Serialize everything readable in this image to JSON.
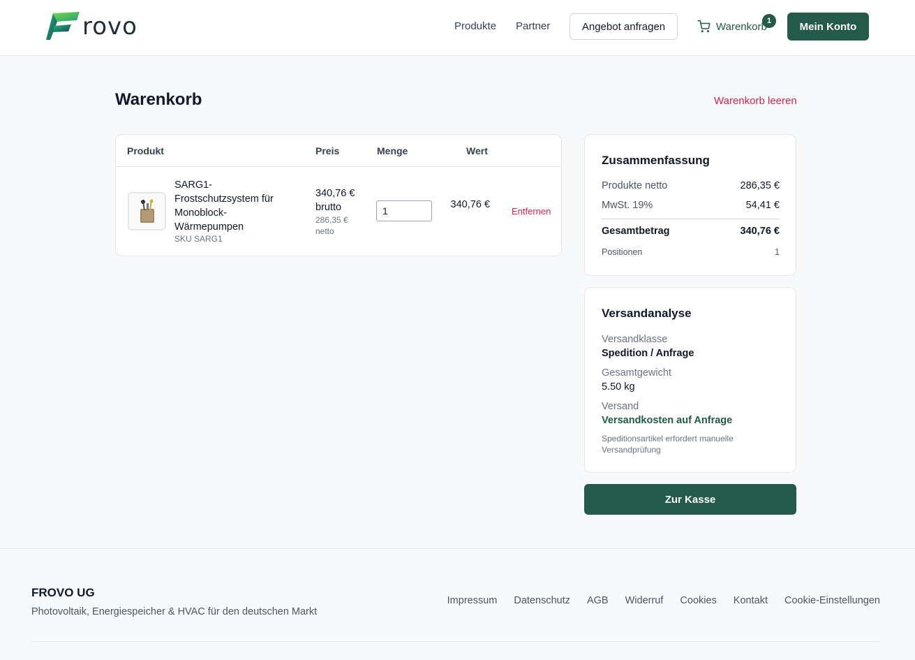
{
  "header": {
    "logo_text": "rovo",
    "nav": [
      "Produkte",
      "Partner"
    ],
    "quote_button": "Angebot anfragen",
    "cart_label": "Warenkorb",
    "cart_count": "1",
    "account_button": "Mein Konto",
    "brand_color": "#245a4a"
  },
  "page": {
    "title": "Warenkorb",
    "clear_cart": "Warenkorb leeren"
  },
  "cart": {
    "columns": {
      "product": "Produkt",
      "price": "Preis",
      "quantity": "Menge",
      "value": "Wert"
    },
    "items": [
      {
        "name": "SARG1-Frostschutzsystem für Monoblock-Wärmepumpen",
        "sku": "SKU SARG1",
        "price_brutto": "340,76 € brutto",
        "price_netto": "286,35 € netto",
        "quantity": "1",
        "value": "340,76 €",
        "remove": "Entfernen"
      }
    ]
  },
  "summary": {
    "title": "Zusammenfassung",
    "net_label": "Produkte netto",
    "net_value": "286,35 €",
    "vat_label": "MwSt. 19%",
    "vat_value": "54,41 €",
    "total_label": "Gesamtbetrag",
    "total_value": "340,76 €",
    "positions_label": "Positionen",
    "positions_value": "1"
  },
  "shipping": {
    "title": "Versandanalyse",
    "class_label": "Versandklasse",
    "class_value": "Spedition / Anfrage",
    "weight_label": "Gesamtgewicht",
    "weight_value": "5.50 kg",
    "shipping_label": "Versand",
    "shipping_value": "Versandkosten auf Anfrage",
    "note": "Speditionsartikel erfordert manuelle Versandprüfung"
  },
  "checkout_button": "Zur Kasse",
  "footer": {
    "brand": "FROVO UG",
    "tagline": "Photovoltaik, Energiespeicher & HVAC für den deutschen Markt",
    "links": [
      "Impressum",
      "Datenschutz",
      "AGB",
      "Widerruf",
      "Cookies",
      "Kontakt",
      "Cookie-Einstellungen"
    ]
  },
  "icons": {
    "cart": "cart-icon",
    "logo": "frovo-logo-icon",
    "product": "product-thumbnail"
  },
  "colors": {
    "accent": "#245a4a",
    "danger": "#d4234a",
    "text": "#111827",
    "muted": "#6b7280"
  }
}
